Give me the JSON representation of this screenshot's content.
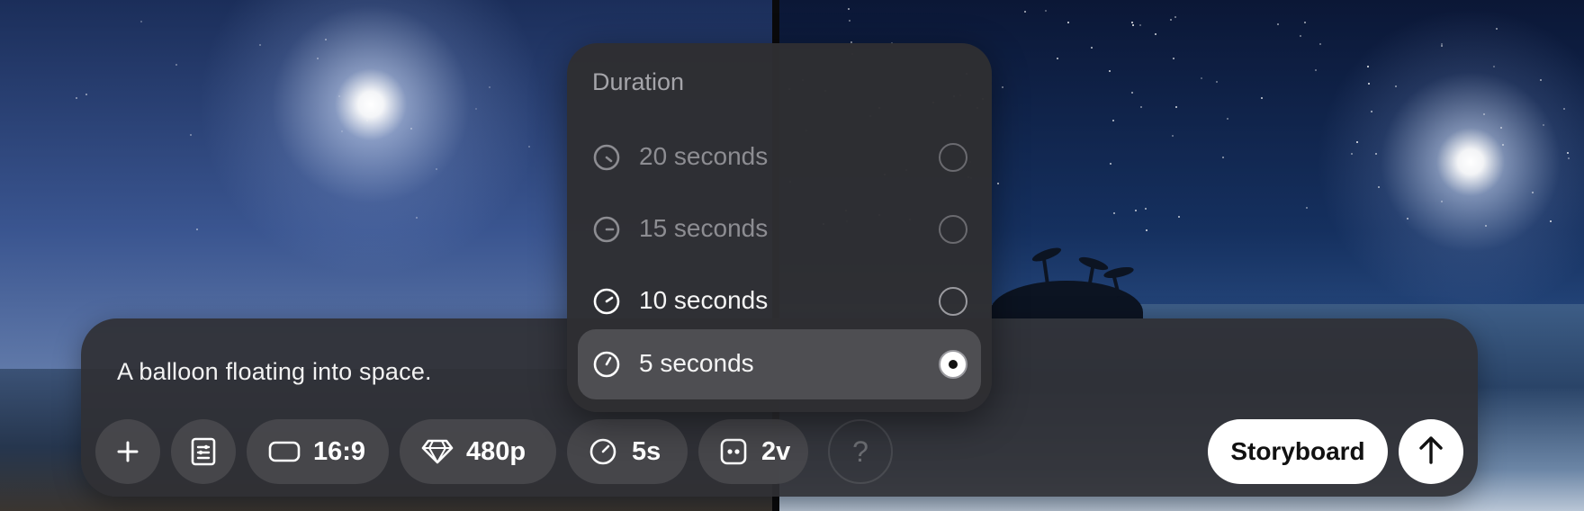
{
  "composer": {
    "prompt": "A balloon floating into space.",
    "toolbar": {
      "add_icon": "plus-icon",
      "preset_icon": "settings-list-icon",
      "aspect_ratio": "16:9",
      "aspect_icon": "rectangle-icon",
      "resolution": "480p",
      "resolution_icon": "diamond-icon",
      "duration": "5s",
      "duration_icon": "timer-icon",
      "variations": "2v",
      "variations_icon": "variations-icon",
      "help": "?"
    },
    "storyboard_label": "Storyboard",
    "submit_icon": "arrow-up-icon"
  },
  "duration_menu": {
    "title": "Duration",
    "options": [
      {
        "label": "20 seconds",
        "selected": false,
        "enabled": false
      },
      {
        "label": "15 seconds",
        "selected": false,
        "enabled": false
      },
      {
        "label": "10 seconds",
        "selected": false,
        "enabled": true
      },
      {
        "label": "5 seconds",
        "selected": true,
        "enabled": true
      }
    ]
  }
}
